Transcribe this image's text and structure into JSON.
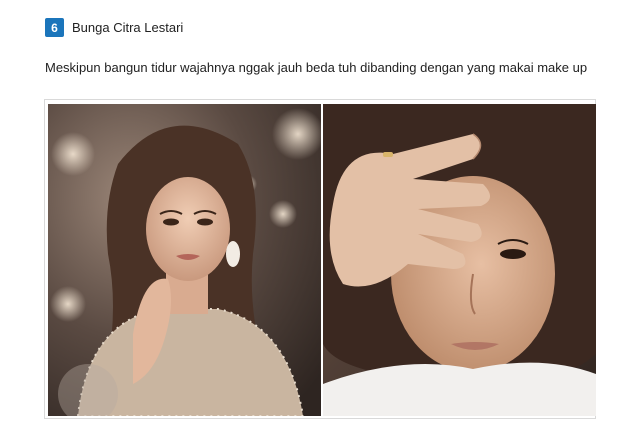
{
  "item": {
    "number": "6",
    "title": "Bunga Citra Lestari",
    "caption": "Meskipun bangun tidur wajahnya nggak jauh beda tuh dibanding dengan yang makai make up"
  },
  "photos": [
    {
      "kind": "with-makeup-portrait"
    },
    {
      "kind": "no-makeup-selfie"
    }
  ],
  "colors": {
    "badge": "#1b75bb",
    "text": "#222222",
    "frame_border": "#d9d9d9"
  }
}
